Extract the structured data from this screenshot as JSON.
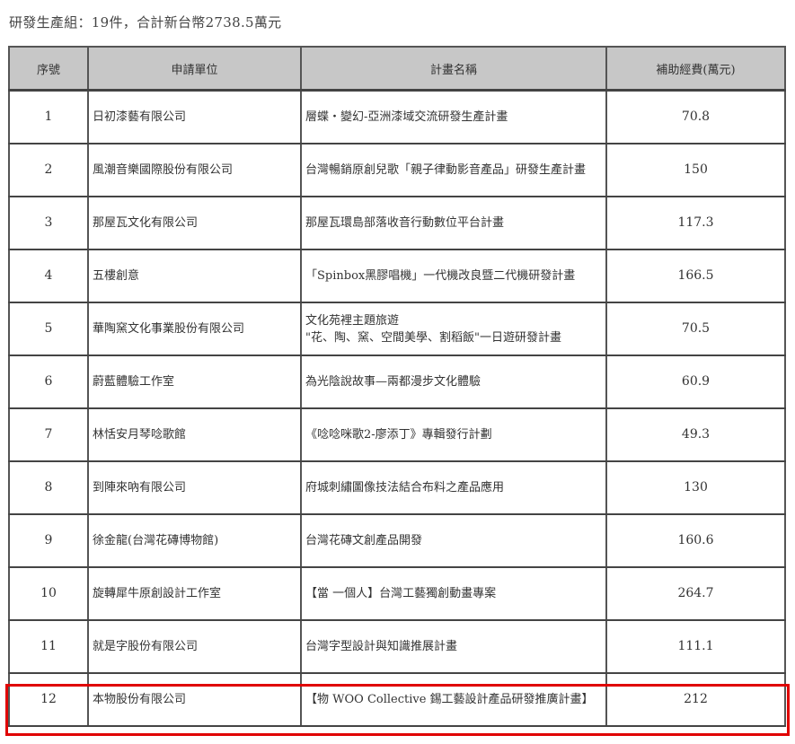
{
  "summary": "研發生產組：19件，合計新台幣2738.5萬元",
  "table": {
    "headers": [
      "序號",
      "申請單位",
      "計畫名稱",
      "補助經費(萬元)"
    ],
    "rows": [
      {
        "no": "1",
        "unit": "日初漆藝有限公司",
        "plan": "層蝶‧變幻-亞洲漆域交流研發生產計畫",
        "amount": "70.8"
      },
      {
        "no": "2",
        "unit": "風潮音樂國際股份有限公司",
        "plan": "台灣暢銷原創兒歌「親子律動影音產品」研發生產計畫",
        "amount": "150"
      },
      {
        "no": "3",
        "unit": "那屋瓦文化有限公司",
        "plan": "那屋瓦環島部落收音行動數位平台計畫",
        "amount": "117.3"
      },
      {
        "no": "4",
        "unit": "五樓創意",
        "plan": "「Spinbox黑膠唱機」一代機改良暨二代機研發計畫",
        "amount": "166.5"
      },
      {
        "no": "5",
        "unit": "華陶窯文化事業股份有限公司",
        "plan": "文化苑裡主題旅遊\n\"花、陶、窯、空間美學、割稻飯\"一日遊研發計畫",
        "amount": "70.5"
      },
      {
        "no": "6",
        "unit": "蔚藍體驗工作室",
        "plan": "為光陰說故事—兩都漫步文化體驗",
        "amount": "60.9"
      },
      {
        "no": "7",
        "unit": "林恬安月琴唸歌館",
        "plan": "《唸唸咪歌2-廖添丁》專輯發行計劃",
        "amount": "49.3"
      },
      {
        "no": "8",
        "unit": "到陣來吶有限公司",
        "plan": "府城刺繡圖像技法結合布料之產品應用",
        "amount": "130"
      },
      {
        "no": "9",
        "unit": "徐金龍(台灣花磚博物館)",
        "plan": "台灣花磚文創產品開發",
        "amount": "160.6"
      },
      {
        "no": "10",
        "unit": "旋轉犀牛原創設計工作室",
        "plan": "【當 一個人】台灣工藝獨創動畫專案",
        "amount": "264.7"
      },
      {
        "no": "11",
        "unit": "就是字股份有限公司",
        "plan": "台灣字型設計與知識推展計畫",
        "amount": "111.1"
      },
      {
        "no": "12",
        "unit": "本物股份有限公司",
        "plan": "【物 WOO Collective 錫工藝設計產品研發推廣計畫】",
        "amount": "212"
      }
    ]
  },
  "highlight_color": "#e00000"
}
